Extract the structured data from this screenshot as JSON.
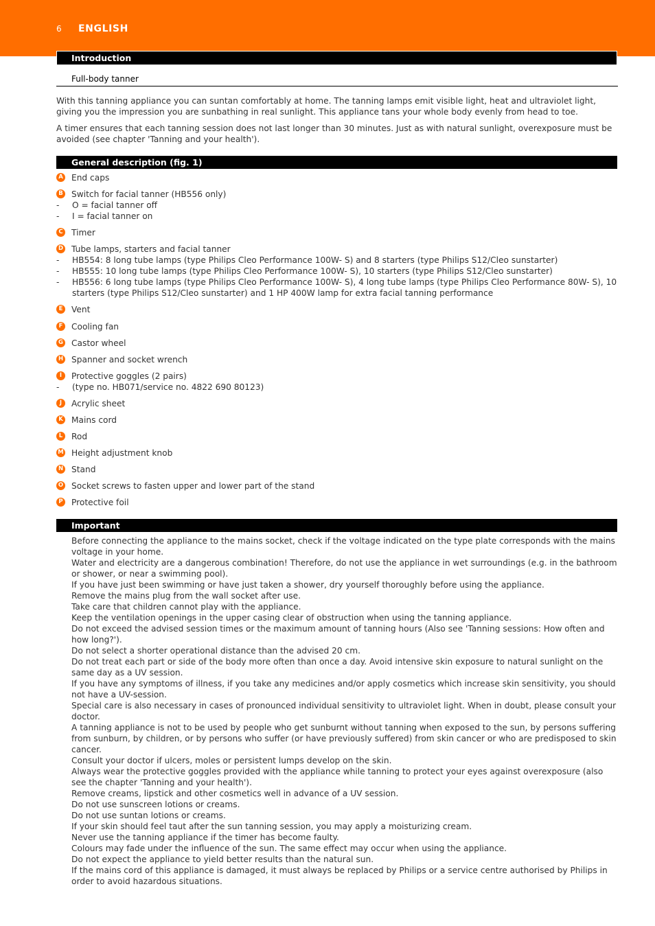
{
  "header": {
    "page_number": "6",
    "language": "ENGLISH",
    "brand_color": "#ff6e00"
  },
  "introduction": {
    "title": "Introduction",
    "subtitle": "Full-body tanner",
    "paragraphs": [
      "With this tanning appliance you can suntan comfortably at home. The tanning lamps emit visible light, heat and ultraviolet light, giving you the impression you are sunbathing in real sunlight. This appliance tans your whole body evenly from head to toe.",
      "A timer ensures that each tanning session does not last longer than 30 minutes. Just as with natural sunlight, overexposure must be avoided (see chapter 'Tanning and your health')."
    ]
  },
  "general_description": {
    "title": "General description (fig. 1)",
    "items": [
      {
        "letter": "A",
        "label": "End caps",
        "subs": []
      },
      {
        "letter": "B",
        "label": "Switch for facial tanner (HB556 only)",
        "subs": [
          "O = facial tanner off",
          "I = facial tanner on"
        ]
      },
      {
        "letter": "C",
        "label": "Timer",
        "subs": []
      },
      {
        "letter": "D",
        "label": "Tube lamps, starters and facial tanner",
        "subs": [
          "HB554: 8 long tube lamps (type Philips Cleo Performance 100W- S) and 8 starters (type Philips S12/Cleo sunstarter)",
          "HB555: 10 long tube lamps (type Philips Cleo Performance 100W- S), 10 starters (type Philips S12/Cleo sunstarter)",
          "HB556: 6 long tube lamps (type Philips Cleo Performance 100W- S), 4 long tube lamps (type Philips Cleo Performance 80W- S), 10 starters (type Philips S12/Cleo sunstarter) and 1 HP 400W lamp for extra facial tanning performance"
        ]
      },
      {
        "letter": "E",
        "label": "Vent",
        "subs": []
      },
      {
        "letter": "F",
        "label": "Cooling fan",
        "subs": []
      },
      {
        "letter": "G",
        "label": "Castor wheel",
        "subs": []
      },
      {
        "letter": "H",
        "label": "Spanner and socket wrench",
        "subs": []
      },
      {
        "letter": "I",
        "label": "Protective goggles (2 pairs)",
        "subs": [
          "(type no. HB071/service no. 4822 690 80123)"
        ]
      },
      {
        "letter": "J",
        "label": "Acrylic sheet",
        "subs": []
      },
      {
        "letter": "K",
        "label": "Mains cord",
        "subs": []
      },
      {
        "letter": "L",
        "label": "Rod",
        "subs": []
      },
      {
        "letter": "M",
        "label": "Height adjustment knob",
        "subs": []
      },
      {
        "letter": "N",
        "label": "Stand",
        "subs": []
      },
      {
        "letter": "O",
        "label": "Socket screws to fasten upper and lower part of the stand",
        "subs": []
      },
      {
        "letter": "P",
        "label": "Protective foil",
        "subs": []
      }
    ]
  },
  "important": {
    "title": "Important",
    "items": [
      "Before connecting the appliance to the mains socket, check if the voltage indicated on the type plate corresponds with the mains voltage in your home.",
      "Water and electricity are a dangerous combination! Therefore, do not use the appliance in wet surroundings (e.g. in the bathroom or shower, or near a swimming pool).",
      "If you have just been swimming or have just taken a shower, dry yourself thoroughly before using the appliance.",
      "Remove the mains plug from the wall socket after use.",
      "Take care that children cannot play with the appliance.",
      "Keep the ventilation openings in the upper casing clear of obstruction when using the tanning appliance.",
      "Do not exceed the advised session times or the maximum amount of tanning hours (Also see 'Tanning sessions: How often and how long?').",
      "Do not select a shorter operational distance than the advised 20 cm.",
      "Do not treat each part or side of the body more often than once a day. Avoid intensive skin exposure to natural sunlight on the same day as a UV session.",
      "If you have any symptoms of illness, if you take any medicines and/or apply cosmetics which increase skin sensitivity, you should not have a UV-session.",
      "Special care is also necessary in cases of pronounced individual sensitivity to ultraviolet light. When in doubt, please consult your doctor.",
      "A tanning appliance is not to be used by people who get sunburnt without tanning when exposed to the sun, by persons suffering from sunburn, by children, or by persons who suffer (or have previously suffered) from skin cancer or who are predisposed to skin cancer.",
      "Consult your doctor if ulcers, moles or persistent lumps develop on the skin.",
      "Always wear the protective goggles provided with the appliance while tanning to protect your eyes against overexposure (also see the chapter 'Tanning and your health').",
      "Remove creams, lipstick and other cosmetics well in advance of a UV session.",
      "Do not use sunscreen lotions or creams.",
      "Do not use suntan lotions or creams.",
      "If your skin should feel taut after the sun tanning session, you may apply a moisturizing cream.",
      "Never use the tanning appliance if the timer has become faulty.",
      "Colours may fade under the influence of the sun. The same effect may occur when using the appliance.",
      "Do not expect the appliance to yield better results than the natural sun.",
      "If the mains cord of this appliance is damaged, it must always be replaced by Philips or a service centre authorised by Philips in order to avoid hazardous situations."
    ]
  }
}
